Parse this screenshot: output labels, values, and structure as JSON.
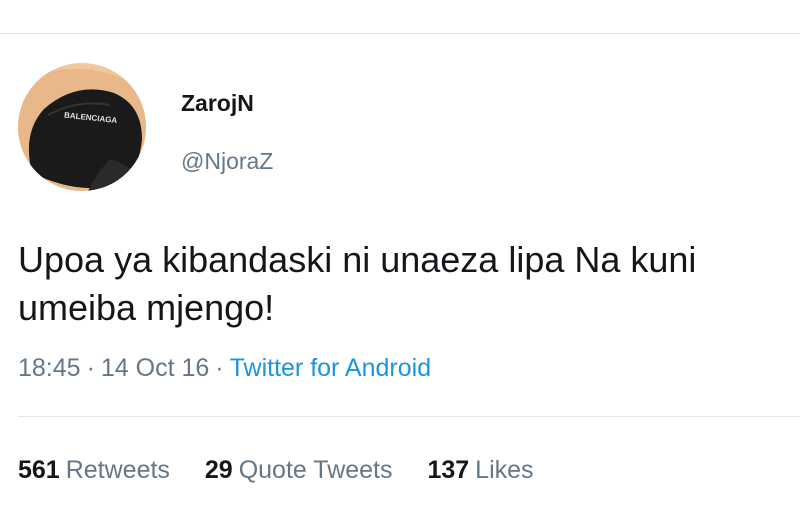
{
  "tweet": {
    "author": {
      "display_name": "ZarojN",
      "handle": "@NjoraZ",
      "avatar_cap_text": "BALENCIAGA"
    },
    "text": "Upoa ya kibandaski ni unaeza lipa Na kuni umeiba mjengo!",
    "time": "18:45",
    "date": "14 Oct 16",
    "separator": "·",
    "source": "Twitter for Android",
    "stats": {
      "retweets_count": "561",
      "retweets_label": "Retweets",
      "quote_tweets_count": "29",
      "quote_tweets_label": "Quote Tweets",
      "likes_count": "137",
      "likes_label": "Likes"
    }
  },
  "colors": {
    "primary_text": "#14171a",
    "secondary_text": "#657786",
    "link": "#1b95e0",
    "divider": "#e1e8ed"
  }
}
